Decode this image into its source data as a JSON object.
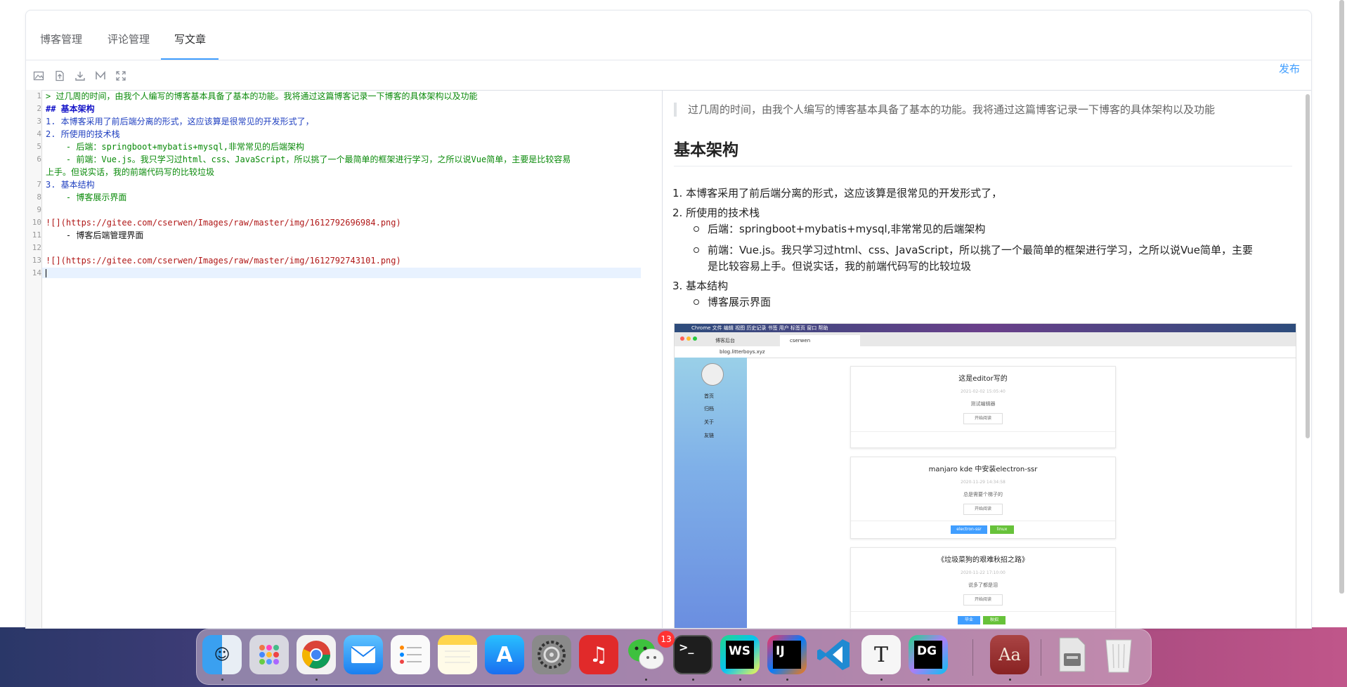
{
  "tabs": [
    "博客管理",
    "评论管理",
    "写文章"
  ],
  "toolbar": {
    "icons": [
      "image-icon",
      "upload-icon",
      "download-icon",
      "markdown-icon",
      "fullscreen-icon"
    ],
    "publish_label": "发布"
  },
  "editor": {
    "line_numbers": [
      "1",
      "2",
      "3",
      "4",
      "5",
      "6",
      "7",
      "8",
      "9",
      "10",
      "11",
      "12",
      "13",
      "14"
    ],
    "lines": [
      "> 过几周的时间，由我个人编写的博客基本具备了基本的功能。我将通过这篇博客记录一下博客的具体架构以及功能",
      "## 基本架构",
      "1. 本博客采用了前后端分离的形式，这应该算是很常见的开发形式了，",
      "2. 所使用的技术栈",
      "    - 后端：springboot+mybatis+mysql,非常常见的后端架构",
      "    - 前端：Vue.js。我只学习过html、css、JavaScript，所以挑了一个最简单的框架进行学习，之所以说Vue简单，主要是比较容易",
      "上手。但说实话，我的前端代码写的比较垃圾",
      "3. 基本结构",
      "    - 博客展示界面",
      "![](https://gitee.com/cserwen/Images/raw/master/img/1612792696984.png)",
      "    - 博客后端管理界面",
      "![](https://gitee.com/cserwen/Images/raw/master/img/1612792743101.png)"
    ]
  },
  "preview": {
    "quote": "过几周的时间，由我个人编写的博客基本具备了基本的功能。我将通过这篇博客记录一下博客的具体架构以及功能",
    "h2": "基本架构",
    "item1": "1. 本博客采用了前后端分离的形式，这应该算是很常见的开发形式了，",
    "item2": "2. 所使用的技术栈",
    "sub1": "后端：springboot+mybatis+mysql,非常常见的后端架构",
    "sub2a": "前端：Vue.js。我只学习过html、css、JavaScript，所以挑了一个最简单的框架进行学习，之所以说Vue简单，主要",
    "sub2b": "是比较容易上手。但说实话，我的前端代码写的比较垃圾",
    "item3": "3. 基本结构",
    "sub3": "博客展示界面"
  },
  "screenshot": {
    "menubar": "Chrome  文件  编辑  视图  历史记录  书签  用户  标签页  窗口  帮助",
    "tab1": "博客后台",
    "tab2": "cserwen",
    "url": "blog.litterboys.xyz",
    "nav": [
      "首页",
      "归档",
      "关于",
      "友链"
    ],
    "posts": [
      {
        "title": "这是editor写的",
        "date": "2021-02-02 15:05:40",
        "desc": "测试编辑器",
        "btn": "开始阅读"
      },
      {
        "title": "manjaro kde 中安装electron-ssr",
        "date": "2020-11-29 14:34:58",
        "desc": "总是需要个梯子的",
        "btn": "开始阅读",
        "tags": [
          "electron-ssr",
          "linux"
        ]
      },
      {
        "title": "《垃圾菜狗的艰难秋招之路》",
        "date": "2020-11-22 17:10:00",
        "desc": "说多了都是泪",
        "btn": "开始阅读",
        "tags": [
          "毕业",
          "秋招"
        ]
      }
    ]
  },
  "dock": {
    "apps": [
      "finder",
      "launchpad",
      "chrome",
      "mail",
      "reminders",
      "notes",
      "app-store",
      "system-preferences",
      "netease-music",
      "wechat",
      "terminal",
      "webstorm",
      "intellij-idea",
      "vscode",
      "typora",
      "datagrip",
      "dictionary",
      "disk-utility",
      "trash"
    ],
    "wechat_badge": "13",
    "labels": {
      "webstorm": "WS",
      "idea": "IJ",
      "datagrip": "DG",
      "typora": "T",
      "dictionary": "Aa",
      "terminal": ">_"
    }
  }
}
